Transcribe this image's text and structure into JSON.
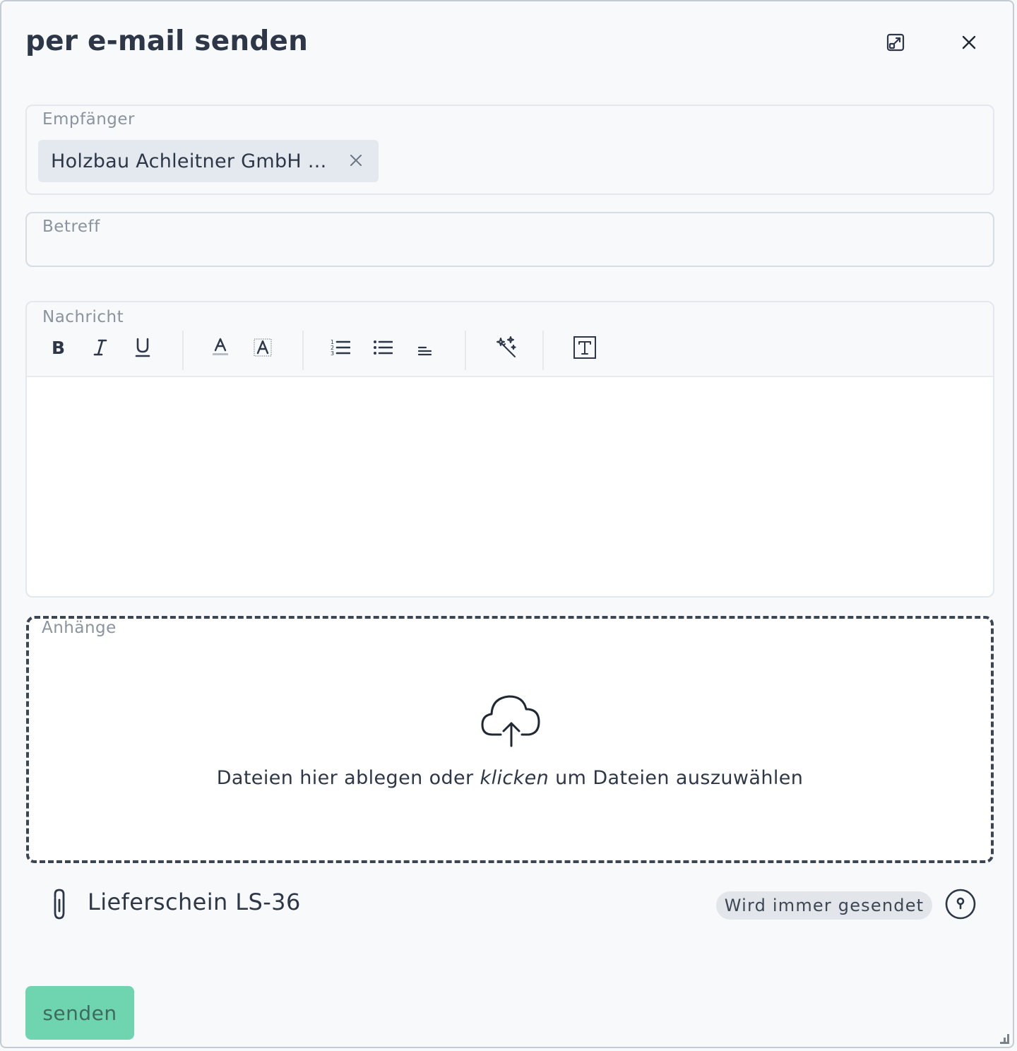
{
  "dialog": {
    "title": "per e-mail senden",
    "icons": {
      "expand": "expand-icon",
      "close": "close-icon"
    }
  },
  "recipients": {
    "label": "Empfänger",
    "chips": [
      {
        "label": "Holzbau Achleitner GmbH ..."
      }
    ]
  },
  "subject": {
    "label": "Betreff",
    "value": ""
  },
  "message": {
    "label": "Nachricht",
    "toolbar": [
      "bold-icon",
      "italic-icon",
      "underline-icon",
      "font-color-icon",
      "highlight-color-icon",
      "ordered-list-icon",
      "bullet-list-icon",
      "align-icon",
      "magic-wand-icon",
      "text-template-icon"
    ],
    "value": ""
  },
  "attachments": {
    "label": "Anhänge",
    "dropzone": {
      "text_before": "Dateien hier ablegen oder ",
      "text_em": "klicken",
      "text_after": " um Dateien auszuwählen"
    },
    "files": [
      {
        "name": "Lieferschein LS-36",
        "badge": "Wird immer gesendet"
      }
    ]
  },
  "actions": {
    "send_label": "senden"
  },
  "colors": {
    "send_button": "#6fd5b1",
    "background": "#f7f9fb",
    "text": "#2d3748"
  }
}
